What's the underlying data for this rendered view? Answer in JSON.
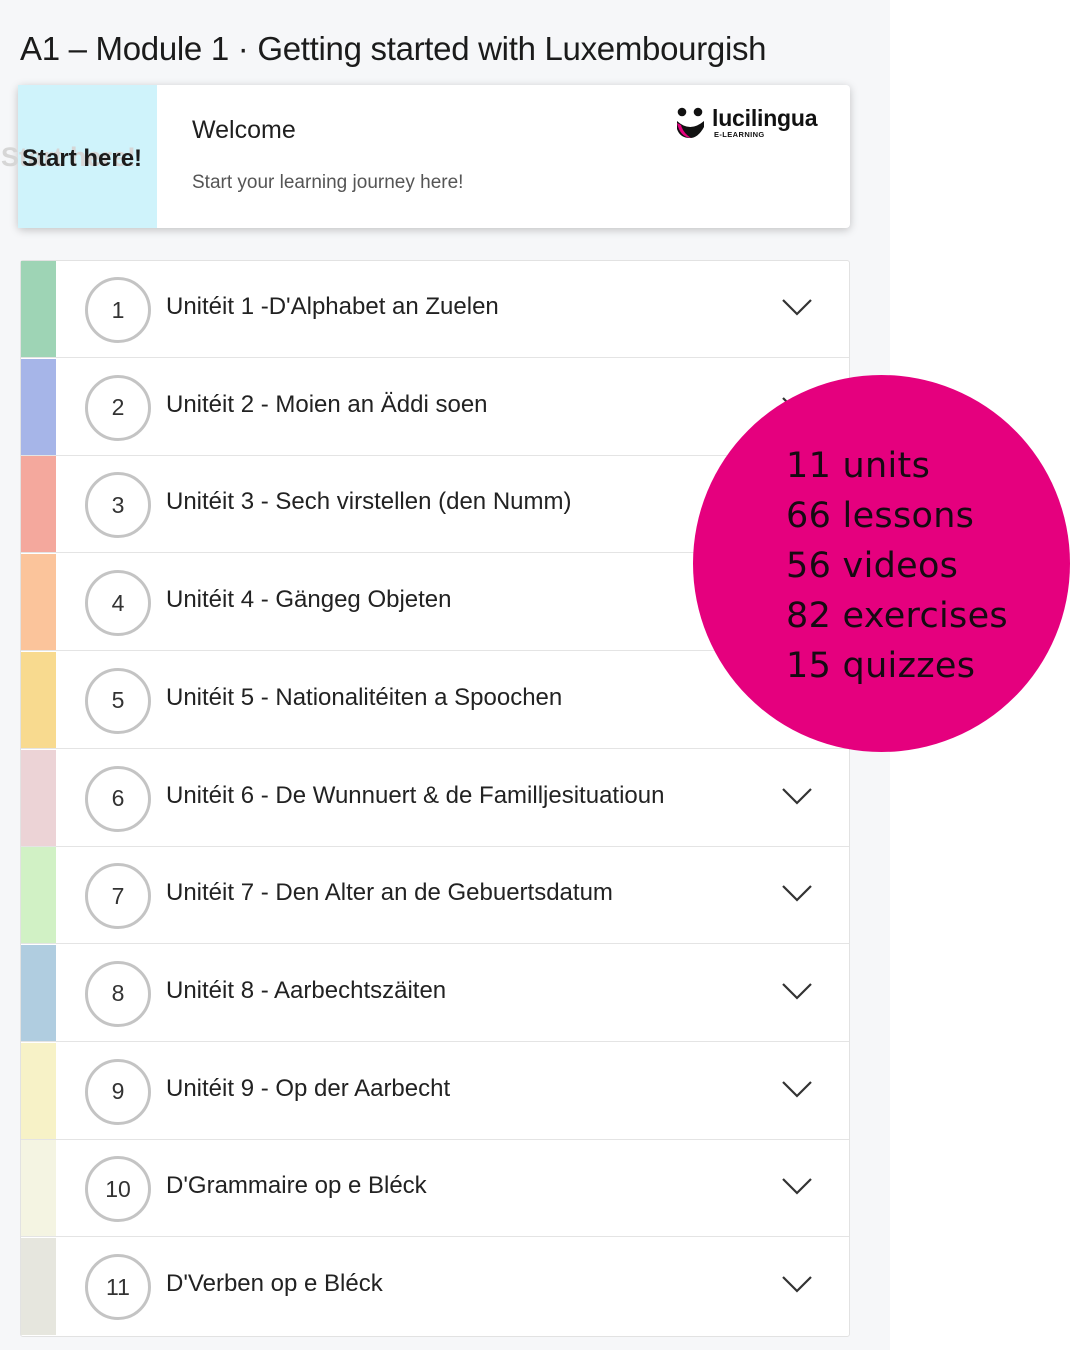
{
  "module": {
    "title": "A1 – Module 1 · Getting started with Luxembourgish"
  },
  "welcome": {
    "thumbnail_label": "Start here!",
    "title": "Welcome",
    "subtitle": "Start your learning journey here!",
    "brand_name": "lucilingua",
    "brand_tagline": "E-LEARNING"
  },
  "units": [
    {
      "number": "1",
      "title": "Unitéit 1 -D'Alphabet an Zuelen",
      "color": "#9ed4b5"
    },
    {
      "number": "2",
      "title": "Unitéit 2 - Moien an Äddi soen",
      "color": "#a6b5e8"
    },
    {
      "number": "3",
      "title": "Unitéit 3 - Sech virstellen (den Numm)",
      "color": "#f4a89d"
    },
    {
      "number": "4",
      "title": "Unitéit 4 - Gängeg Objeten",
      "color": "#fbc49b"
    },
    {
      "number": "5",
      "title": "Unitéit 5 - Nationalitéiten a Spoochen",
      "color": "#f8da8f"
    },
    {
      "number": "6",
      "title": "Unitéit 6 - De Wunnuert & de Familljesituatioun",
      "color": "#ecd3d6"
    },
    {
      "number": "7",
      "title": "Unitéit 7 - Den Alter an de Gebuertsdatum",
      "color": "#d1f1c5"
    },
    {
      "number": "8",
      "title": "Unitéit 8 - Aarbechtszäiten",
      "color": "#b0cde0"
    },
    {
      "number": "9",
      "title": "Unitéit 9 - Op der Aarbecht",
      "color": "#f7f2c7"
    },
    {
      "number": "10",
      "title": "D'Grammaire op e Bléck",
      "color": "#f4f4e2"
    },
    {
      "number": "11",
      "title": "D'Verben op e Bléck",
      "color": "#e6e6de"
    }
  ],
  "stats": [
    "11 units",
    "66 lessons",
    "56 videos",
    "82 exercises",
    "15 quizzes"
  ],
  "colors": {
    "stats_bubble": "#e5007e",
    "welcome_thumbnail": "#cff3fb",
    "brand_accent": "#e5007e"
  },
  "icons": {
    "expand": "chevron-down-icon",
    "brand": "lucilingua-logo-icon"
  }
}
